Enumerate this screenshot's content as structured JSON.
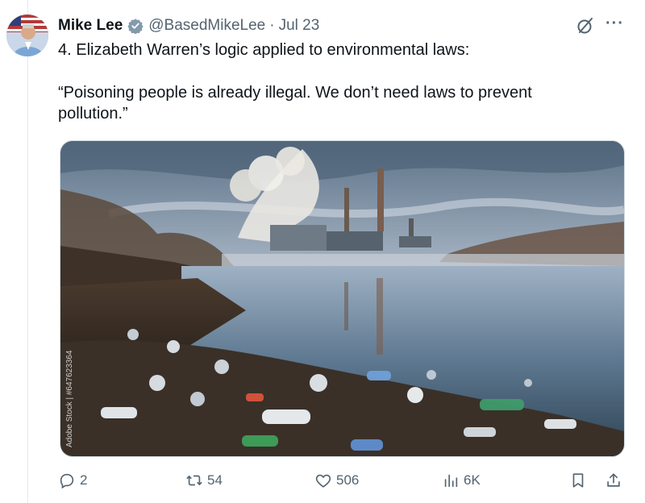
{
  "tweet": {
    "display_name": "Mike Lee",
    "handle": "@BasedMikeLee",
    "separator": "·",
    "date": "Jul 23",
    "text_line1": "4. Elizabeth Warren’s logic applied to environmental laws:",
    "text_line2": "“Poisoning people is already illegal. We don’t need laws to prevent pollution.”",
    "image_watermark": "Adobe Stock | #647623364"
  },
  "actions": {
    "replies": "2",
    "reposts": "54",
    "likes": "506",
    "views": "6K"
  },
  "icons": {
    "verified": "verified-badge-icon",
    "grok": "grok-icon",
    "more": "more-icon",
    "reply": "reply-icon",
    "repost": "repost-icon",
    "like": "like-icon",
    "views": "views-icon",
    "bookmark": "bookmark-icon",
    "share": "share-icon"
  },
  "colors": {
    "text": "#0f1419",
    "secondary": "#536471",
    "verified": "#829aab"
  }
}
